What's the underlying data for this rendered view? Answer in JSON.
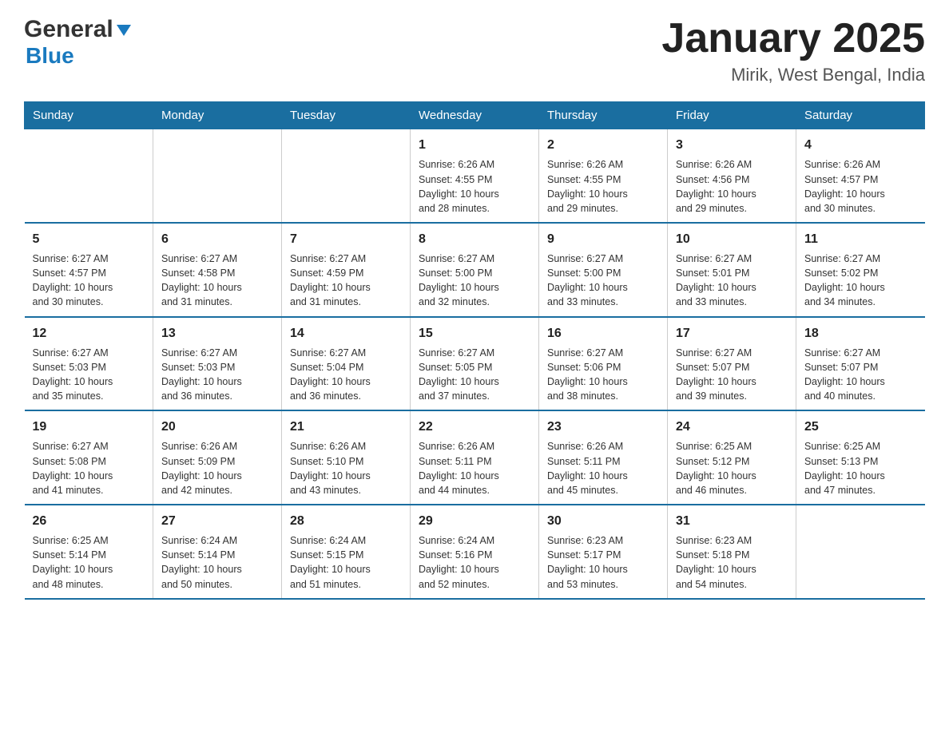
{
  "header": {
    "logo_general": "General",
    "logo_blue": "Blue",
    "title": "January 2025",
    "subtitle": "Mirik, West Bengal, India"
  },
  "days_of_week": [
    "Sunday",
    "Monday",
    "Tuesday",
    "Wednesday",
    "Thursday",
    "Friday",
    "Saturday"
  ],
  "weeks": [
    [
      {
        "day": "",
        "sunrise": "",
        "sunset": "",
        "daylight": ""
      },
      {
        "day": "",
        "sunrise": "",
        "sunset": "",
        "daylight": ""
      },
      {
        "day": "",
        "sunrise": "",
        "sunset": "",
        "daylight": ""
      },
      {
        "day": "1",
        "sunrise": "Sunrise: 6:26 AM",
        "sunset": "Sunset: 4:55 PM",
        "daylight": "Daylight: 10 hours and 28 minutes."
      },
      {
        "day": "2",
        "sunrise": "Sunrise: 6:26 AM",
        "sunset": "Sunset: 4:55 PM",
        "daylight": "Daylight: 10 hours and 29 minutes."
      },
      {
        "day": "3",
        "sunrise": "Sunrise: 6:26 AM",
        "sunset": "Sunset: 4:56 PM",
        "daylight": "Daylight: 10 hours and 29 minutes."
      },
      {
        "day": "4",
        "sunrise": "Sunrise: 6:26 AM",
        "sunset": "Sunset: 4:57 PM",
        "daylight": "Daylight: 10 hours and 30 minutes."
      }
    ],
    [
      {
        "day": "5",
        "sunrise": "Sunrise: 6:27 AM",
        "sunset": "Sunset: 4:57 PM",
        "daylight": "Daylight: 10 hours and 30 minutes."
      },
      {
        "day": "6",
        "sunrise": "Sunrise: 6:27 AM",
        "sunset": "Sunset: 4:58 PM",
        "daylight": "Daylight: 10 hours and 31 minutes."
      },
      {
        "day": "7",
        "sunrise": "Sunrise: 6:27 AM",
        "sunset": "Sunset: 4:59 PM",
        "daylight": "Daylight: 10 hours and 31 minutes."
      },
      {
        "day": "8",
        "sunrise": "Sunrise: 6:27 AM",
        "sunset": "Sunset: 5:00 PM",
        "daylight": "Daylight: 10 hours and 32 minutes."
      },
      {
        "day": "9",
        "sunrise": "Sunrise: 6:27 AM",
        "sunset": "Sunset: 5:00 PM",
        "daylight": "Daylight: 10 hours and 33 minutes."
      },
      {
        "day": "10",
        "sunrise": "Sunrise: 6:27 AM",
        "sunset": "Sunset: 5:01 PM",
        "daylight": "Daylight: 10 hours and 33 minutes."
      },
      {
        "day": "11",
        "sunrise": "Sunrise: 6:27 AM",
        "sunset": "Sunset: 5:02 PM",
        "daylight": "Daylight: 10 hours and 34 minutes."
      }
    ],
    [
      {
        "day": "12",
        "sunrise": "Sunrise: 6:27 AM",
        "sunset": "Sunset: 5:03 PM",
        "daylight": "Daylight: 10 hours and 35 minutes."
      },
      {
        "day": "13",
        "sunrise": "Sunrise: 6:27 AM",
        "sunset": "Sunset: 5:03 PM",
        "daylight": "Daylight: 10 hours and 36 minutes."
      },
      {
        "day": "14",
        "sunrise": "Sunrise: 6:27 AM",
        "sunset": "Sunset: 5:04 PM",
        "daylight": "Daylight: 10 hours and 36 minutes."
      },
      {
        "day": "15",
        "sunrise": "Sunrise: 6:27 AM",
        "sunset": "Sunset: 5:05 PM",
        "daylight": "Daylight: 10 hours and 37 minutes."
      },
      {
        "day": "16",
        "sunrise": "Sunrise: 6:27 AM",
        "sunset": "Sunset: 5:06 PM",
        "daylight": "Daylight: 10 hours and 38 minutes."
      },
      {
        "day": "17",
        "sunrise": "Sunrise: 6:27 AM",
        "sunset": "Sunset: 5:07 PM",
        "daylight": "Daylight: 10 hours and 39 minutes."
      },
      {
        "day": "18",
        "sunrise": "Sunrise: 6:27 AM",
        "sunset": "Sunset: 5:07 PM",
        "daylight": "Daylight: 10 hours and 40 minutes."
      }
    ],
    [
      {
        "day": "19",
        "sunrise": "Sunrise: 6:27 AM",
        "sunset": "Sunset: 5:08 PM",
        "daylight": "Daylight: 10 hours and 41 minutes."
      },
      {
        "day": "20",
        "sunrise": "Sunrise: 6:26 AM",
        "sunset": "Sunset: 5:09 PM",
        "daylight": "Daylight: 10 hours and 42 minutes."
      },
      {
        "day": "21",
        "sunrise": "Sunrise: 6:26 AM",
        "sunset": "Sunset: 5:10 PM",
        "daylight": "Daylight: 10 hours and 43 minutes."
      },
      {
        "day": "22",
        "sunrise": "Sunrise: 6:26 AM",
        "sunset": "Sunset: 5:11 PM",
        "daylight": "Daylight: 10 hours and 44 minutes."
      },
      {
        "day": "23",
        "sunrise": "Sunrise: 6:26 AM",
        "sunset": "Sunset: 5:11 PM",
        "daylight": "Daylight: 10 hours and 45 minutes."
      },
      {
        "day": "24",
        "sunrise": "Sunrise: 6:25 AM",
        "sunset": "Sunset: 5:12 PM",
        "daylight": "Daylight: 10 hours and 46 minutes."
      },
      {
        "day": "25",
        "sunrise": "Sunrise: 6:25 AM",
        "sunset": "Sunset: 5:13 PM",
        "daylight": "Daylight: 10 hours and 47 minutes."
      }
    ],
    [
      {
        "day": "26",
        "sunrise": "Sunrise: 6:25 AM",
        "sunset": "Sunset: 5:14 PM",
        "daylight": "Daylight: 10 hours and 48 minutes."
      },
      {
        "day": "27",
        "sunrise": "Sunrise: 6:24 AM",
        "sunset": "Sunset: 5:14 PM",
        "daylight": "Daylight: 10 hours and 50 minutes."
      },
      {
        "day": "28",
        "sunrise": "Sunrise: 6:24 AM",
        "sunset": "Sunset: 5:15 PM",
        "daylight": "Daylight: 10 hours and 51 minutes."
      },
      {
        "day": "29",
        "sunrise": "Sunrise: 6:24 AM",
        "sunset": "Sunset: 5:16 PM",
        "daylight": "Daylight: 10 hours and 52 minutes."
      },
      {
        "day": "30",
        "sunrise": "Sunrise: 6:23 AM",
        "sunset": "Sunset: 5:17 PM",
        "daylight": "Daylight: 10 hours and 53 minutes."
      },
      {
        "day": "31",
        "sunrise": "Sunrise: 6:23 AM",
        "sunset": "Sunset: 5:18 PM",
        "daylight": "Daylight: 10 hours and 54 minutes."
      },
      {
        "day": "",
        "sunrise": "",
        "sunset": "",
        "daylight": ""
      }
    ]
  ]
}
